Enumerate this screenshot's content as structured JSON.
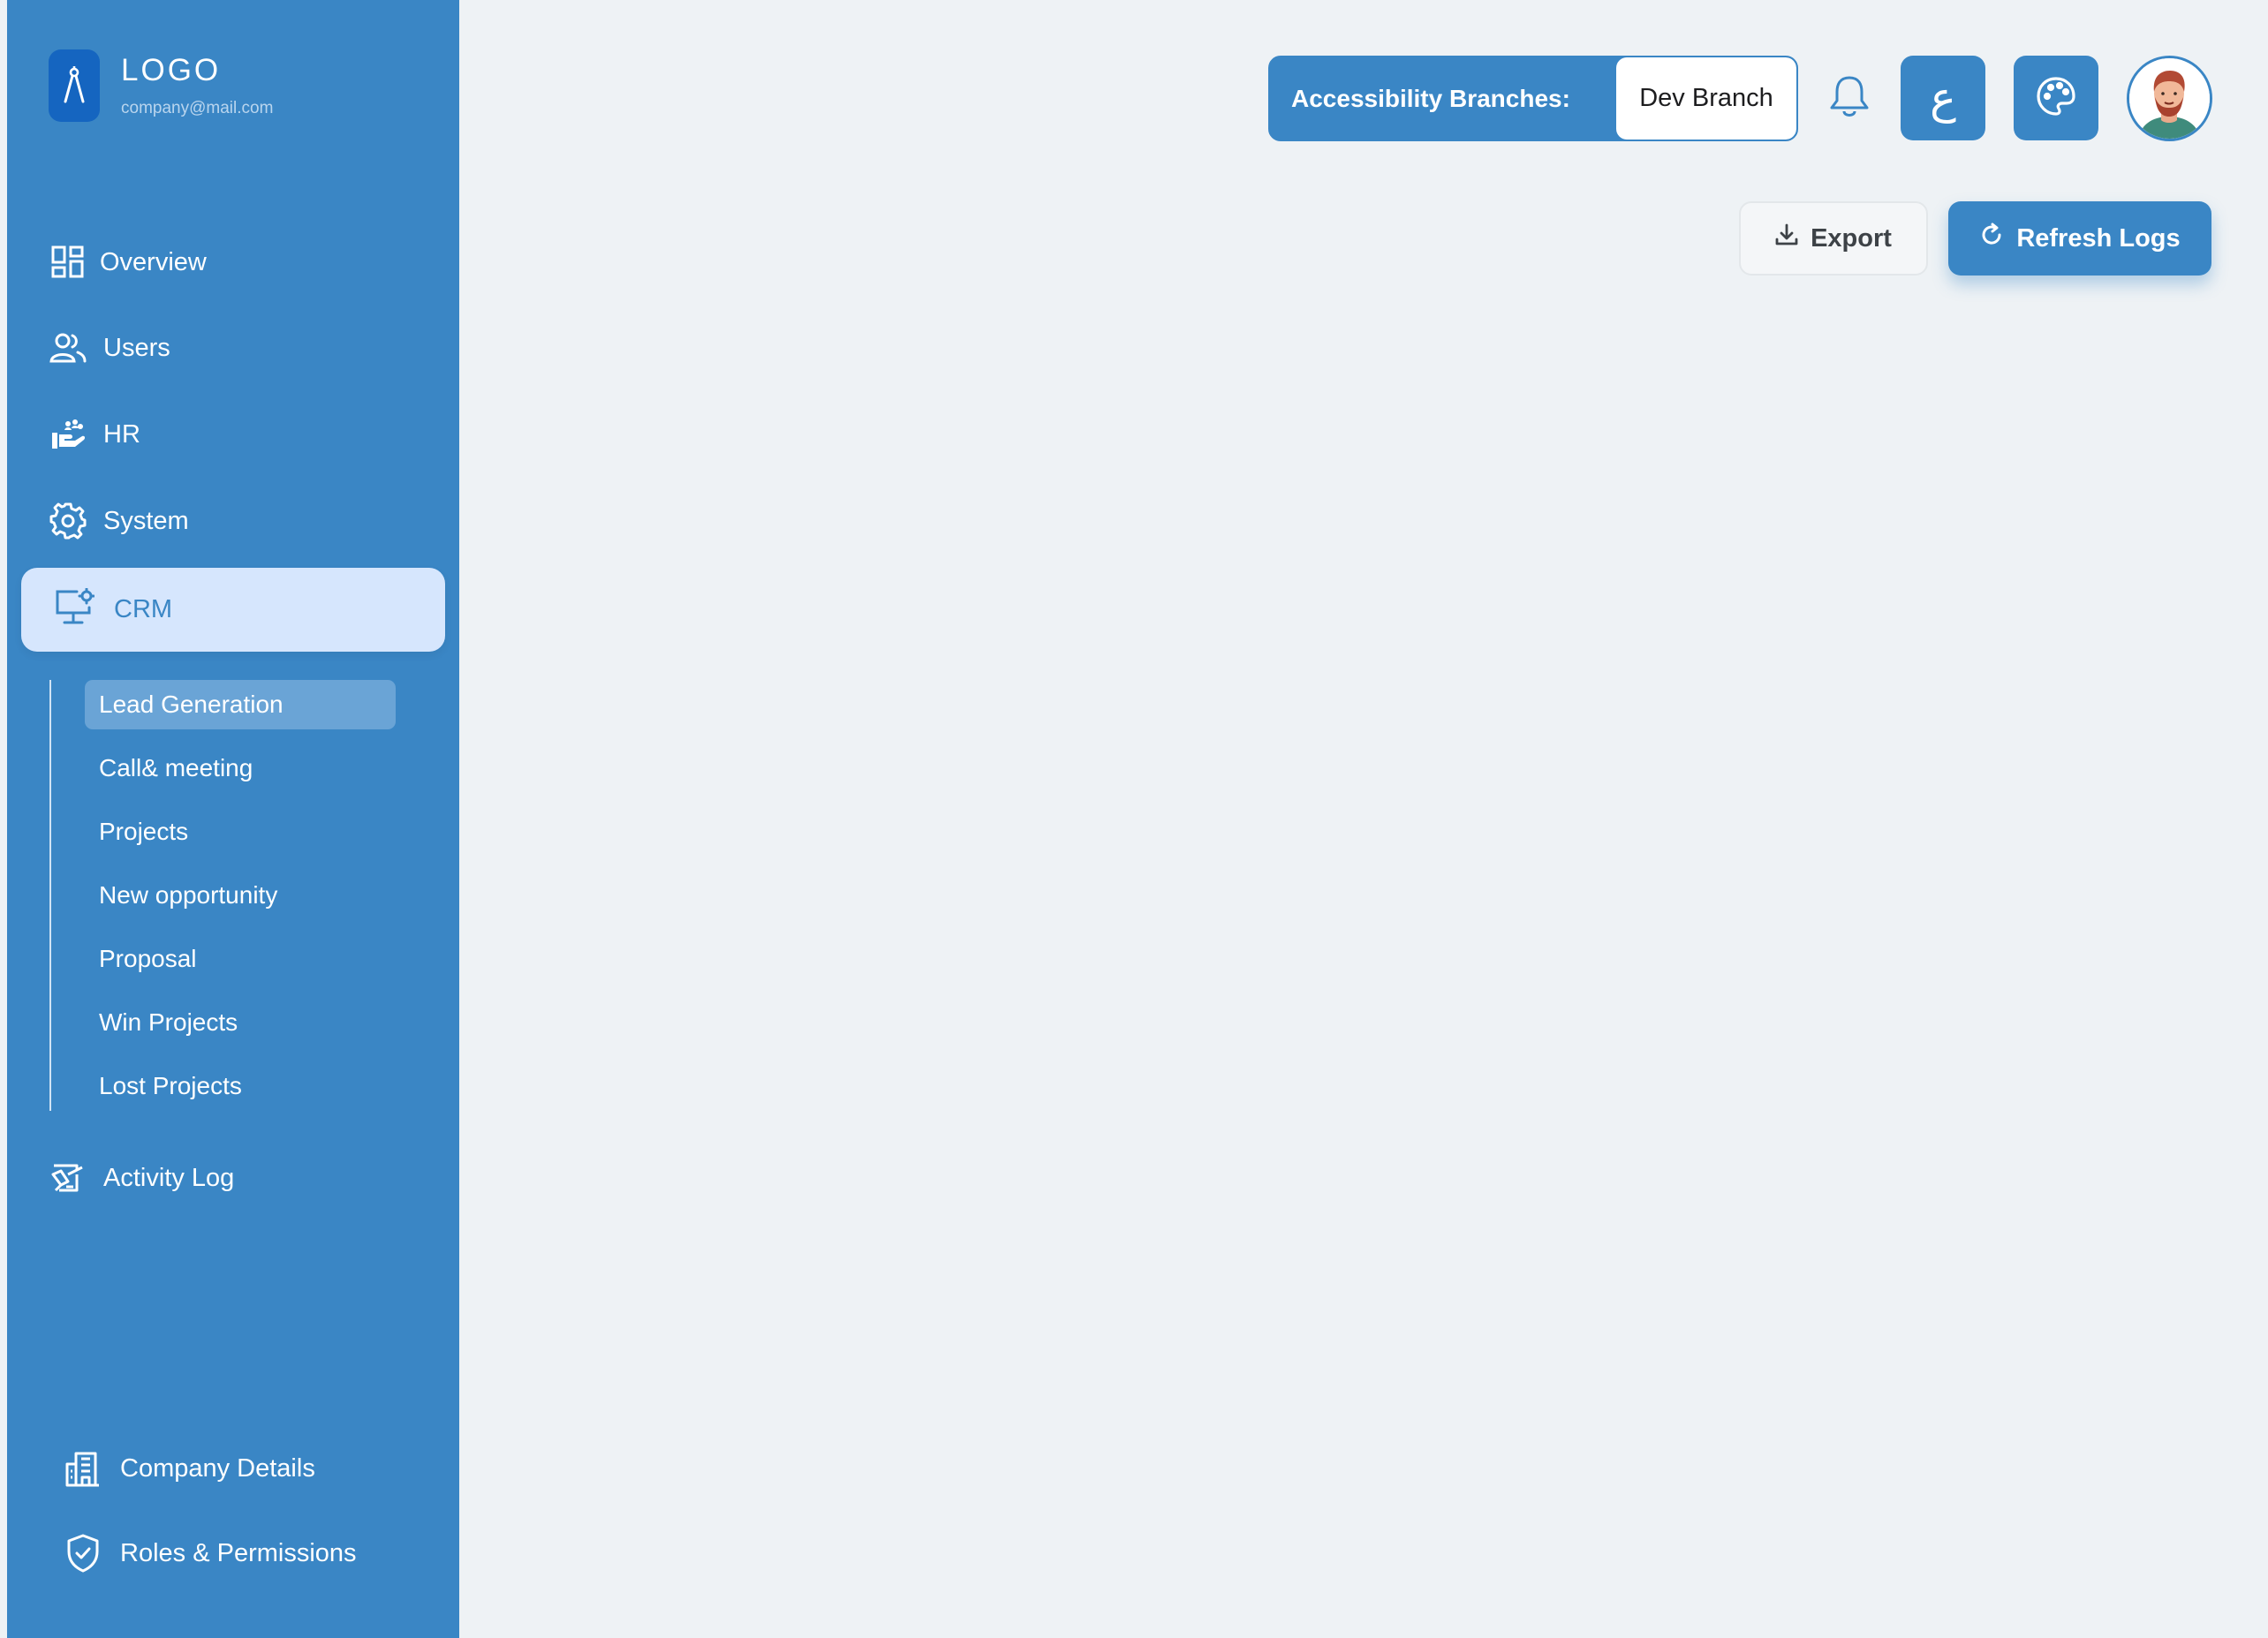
{
  "sidebar": {
    "logo_title": "LOGO",
    "logo_email": "company@mail.com",
    "items": [
      {
        "label": "Overview",
        "icon": "overview-icon"
      },
      {
        "label": "Users",
        "icon": "users-icon"
      },
      {
        "label": "HR",
        "icon": "hr-icon"
      },
      {
        "label": "System",
        "icon": "gear-icon"
      },
      {
        "label": "CRM",
        "icon": "monitor-gear-icon",
        "active": true
      },
      {
        "label": "Activity Log",
        "icon": "activity-log-icon"
      },
      {
        "label": "Company Details",
        "icon": "building-icon"
      },
      {
        "label": "Roles & Permissions",
        "icon": "shield-check-icon"
      }
    ],
    "crm_submenu": [
      {
        "label": "Lead Generation",
        "active": true
      },
      {
        "label": "Call& meeting"
      },
      {
        "label": "Projects"
      },
      {
        "label": "New opportunity"
      },
      {
        "label": "Proposal"
      },
      {
        "label": "Win Projects"
      },
      {
        "label": "Lost Projects"
      }
    ]
  },
  "header": {
    "branch_label": "Accessibility Branches:",
    "branch_value": "Dev Branch",
    "language_glyph": "ع",
    "icons": [
      "bell-icon",
      "language-icon",
      "palette-icon",
      "avatar"
    ]
  },
  "toolbar": {
    "export_label": "Export",
    "refresh_label": "Refresh Logs"
  },
  "colors": {
    "primary": "#3a86c5",
    "active_bg": "#d6e6fd",
    "page_bg": "#eef2f5"
  }
}
